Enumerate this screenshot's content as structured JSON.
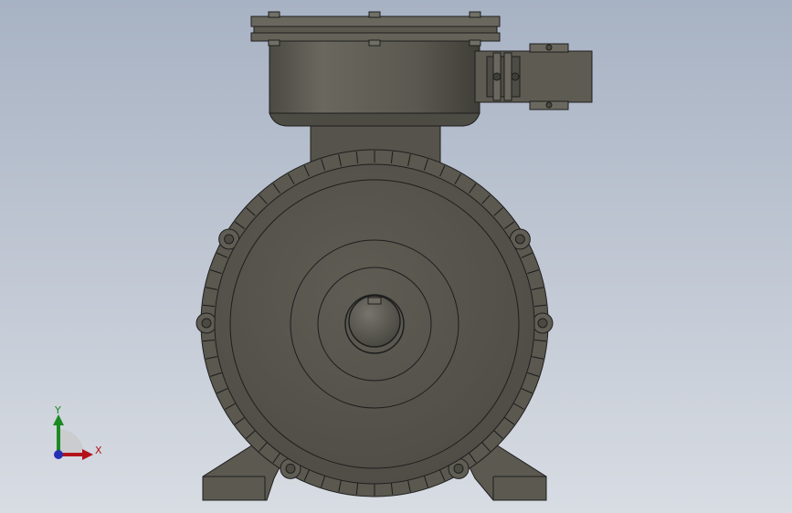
{
  "viewport": {
    "background_top": "#a9b4c4",
    "background_bottom": "#d6dbe2",
    "model": {
      "name": "motor-front-view",
      "body_color": "#5b5950",
      "edge_color": "#1e1e1e",
      "highlight_color": "#8a877c"
    }
  },
  "triad": {
    "x_label": "X",
    "y_label": "Y",
    "x_color": "#b3121b",
    "y_color": "#1a8a22",
    "z_color": "#2630b5"
  }
}
